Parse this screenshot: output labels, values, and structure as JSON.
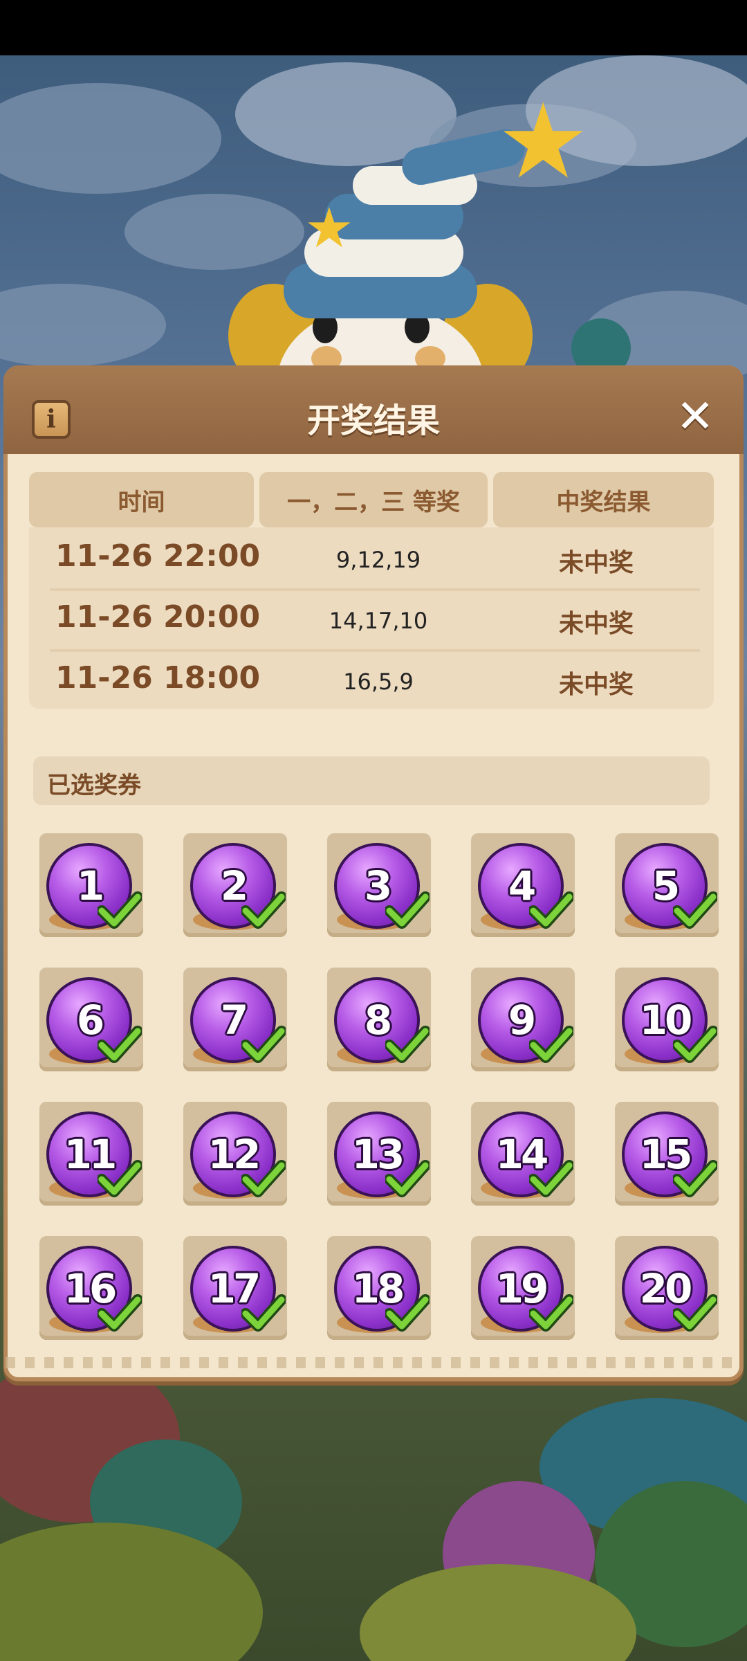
{
  "header": {
    "title": "开奖结果",
    "info_icon": "info-icon",
    "close_icon": "close-icon"
  },
  "results_table": {
    "columns": [
      "时间",
      "一，二，三 等奖",
      "中奖结果"
    ],
    "rows": [
      {
        "time": "11-26 22:00",
        "numbers": "9,12,19",
        "result": "未中奖"
      },
      {
        "time": "11-26 20:00",
        "numbers": "14,17,10",
        "result": "未中奖"
      },
      {
        "time": "11-26 18:00",
        "numbers": "16,5,9",
        "result": "未中奖"
      }
    ]
  },
  "selected_section": {
    "label": "已选奖券"
  },
  "tickets": [
    {
      "number": "1",
      "selected": true
    },
    {
      "number": "2",
      "selected": true
    },
    {
      "number": "3",
      "selected": true
    },
    {
      "number": "4",
      "selected": true
    },
    {
      "number": "5",
      "selected": true
    },
    {
      "number": "6",
      "selected": true
    },
    {
      "number": "7",
      "selected": true
    },
    {
      "number": "8",
      "selected": true
    },
    {
      "number": "9",
      "selected": true
    },
    {
      "number": "10",
      "selected": true
    },
    {
      "number": "11",
      "selected": true
    },
    {
      "number": "12",
      "selected": true
    },
    {
      "number": "13",
      "selected": true
    },
    {
      "number": "14",
      "selected": true
    },
    {
      "number": "15",
      "selected": true
    },
    {
      "number": "16",
      "selected": true
    },
    {
      "number": "17",
      "selected": true
    },
    {
      "number": "18",
      "selected": true
    },
    {
      "number": "19",
      "selected": true
    },
    {
      "number": "20",
      "selected": true
    }
  ],
  "colors": {
    "ball": "#9b3fd6",
    "check": "#7cd33a",
    "panel": "#f3e6cc",
    "header": "#9a6d46"
  }
}
